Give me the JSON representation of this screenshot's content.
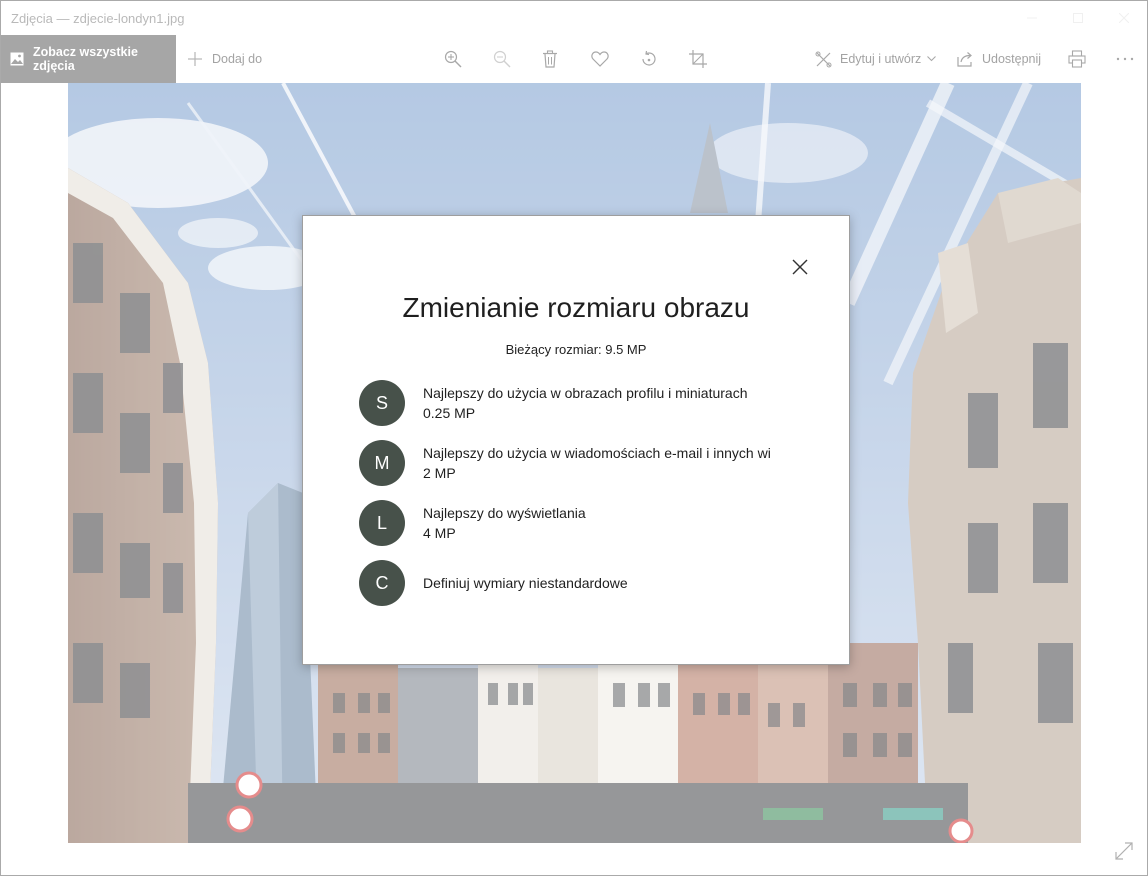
{
  "window": {
    "title": "Zdjęcia — zdjecie-londyn1.jpg"
  },
  "toolbar": {
    "see_all_label": "Zobacz wszystkie zdjęcia",
    "add_to_label": "Dodaj do",
    "edit_create_label": "Edytuj i utwórz",
    "share_label": "Udostępnij",
    "icons": [
      "zoom-in-icon",
      "zoom-out-icon",
      "delete-icon",
      "favorite-icon",
      "rotate-icon",
      "crop-icon",
      "print-icon",
      "more-icon"
    ]
  },
  "dialog": {
    "title": "Zmienianie rozmiaru obrazu",
    "current_size": "Bieżący rozmiar: 9.5 MP",
    "options": [
      {
        "badge": "S",
        "description": "Najlepszy do użycia w obrazach profilu i miniaturach",
        "size": "0.25 MP"
      },
      {
        "badge": "M",
        "description": "Najlepszy do użycia w wiadomościach e-mail i innych wi",
        "size": "2 MP"
      },
      {
        "badge": "L",
        "description": "Najlepszy do wyświetlania",
        "size": "4 MP"
      },
      {
        "badge": "C",
        "description": "Definiuj wymiary niestandardowe"
      }
    ]
  },
  "colors": {
    "badge": "#47514a",
    "toolbar_active": "#a6a6a6",
    "text_muted": "#a3a3a3"
  }
}
